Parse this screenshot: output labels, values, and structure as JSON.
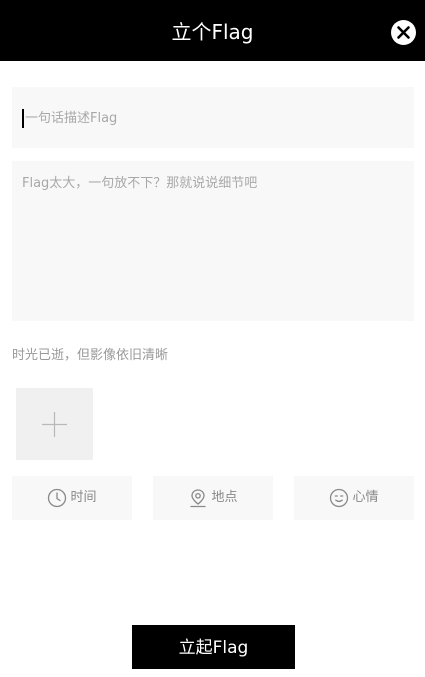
{
  "header": {
    "title": "立个Flag",
    "close_icon": "close-circle-icon"
  },
  "form": {
    "title_placeholder": "一句话描述Flag",
    "title_value": "",
    "description_placeholder": "Flag太大，一句放不下？那就说说细节吧",
    "description_value": "",
    "photo_caption": "时光已逝，但影像依旧清晰",
    "add_photo_icon": "plus-icon"
  },
  "options": {
    "time_label": "时间",
    "time_icon": "clock-icon",
    "location_label": "地点",
    "location_icon": "location-pin-icon",
    "mood_label": "心情",
    "mood_icon": "smiley-face-icon"
  },
  "submit": {
    "label": "立起Flag"
  },
  "colors": {
    "header_bg": "#000000",
    "field_bg": "#f8f8f8",
    "button_bg": "#000000",
    "placeholder": "#a8a8a8"
  }
}
